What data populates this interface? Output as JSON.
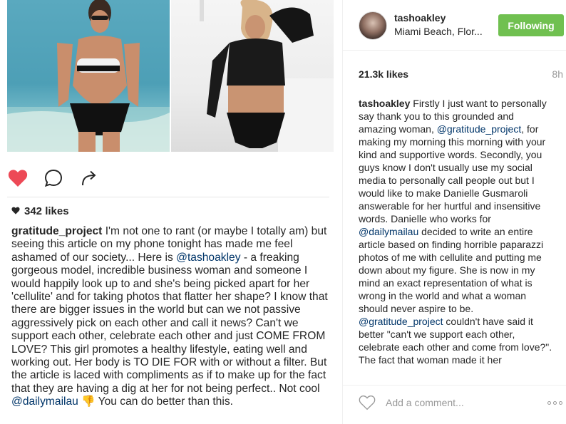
{
  "left_post": {
    "likes": "342 likes",
    "caption": {
      "username": "gratitude_project",
      "part1": " I'm not one to rant (or maybe I totally am) but seeing this article on my phone tonight has made me feel ashamed of our society... Here is ",
      "mention1": "@tashoakley",
      "part2": " - a freaking gorgeous model, incredible business woman and someone I would happily look up to and she's being picked apart for her 'cellulite' and for taking photos that flatter her shape?  I know that there are bigger issues in the world but can we not passive aggressively pick on each other and call it news?  Can't we support each other, celebrate each other and just COME FROM LOVE?  This girl promotes a healthy lifestyle, eating well and working out. Her body is TO DIE FOR with or without a filter. But the article is laced with compliments as if to make up for the fact that they are having a dig at her for not being perfect.. Not cool ",
      "mention2": "@dailymailau",
      "emoji": "👎",
      "part3": " You can do better than this."
    },
    "icons": {
      "like": "heart-filled-icon",
      "comment": "comment-bubble-icon",
      "share": "share-arrow-icon",
      "likes_heart": "small-heart-icon"
    },
    "colors": {
      "heart": "#ed4956"
    }
  },
  "right_panel": {
    "username": "tashoakley",
    "location": "Miami Beach, Flor...",
    "follow_label": "Following",
    "likes": "21.3k likes",
    "time": "8h",
    "caption": {
      "username": "tashoakley",
      "part1": " Firstly I just want to personally say thank you to this grounded and amazing woman, ",
      "mention1": "@gratitude_project",
      "part2": ", for making my morning this morning with your kind and supportive words. Secondly, you guys know I don't usually use my social media to personally call people out but I would like to make Danielle Gusmaroli answerable for her hurtful and insensitive words. Danielle who works for ",
      "mention2": "@dailymailau",
      "part3": " decided to write an entire article based on finding horrible paparazzi photos of me with cellulite and putting me down about my figure. She is now in my mind an exact representation of what is wrong in the world and what a woman should never aspire to be. ",
      "mention3": "@gratitude_project",
      "part4": " couldn't have said it better \"can't we support each other, celebrate each other and come from love?\". The fact that woman made it her"
    },
    "comment_placeholder": "Add a comment...",
    "colors": {
      "follow_button": "#70c050",
      "mention": "#003569"
    }
  }
}
